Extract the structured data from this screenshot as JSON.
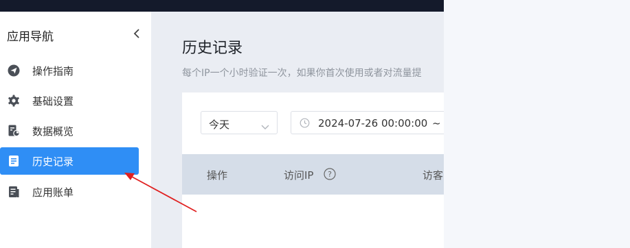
{
  "sidebar": {
    "title": "应用导航",
    "items": [
      {
        "label": "操作指南",
        "icon": "paper-plane-icon",
        "active": false
      },
      {
        "label": "基础设置",
        "icon": "gear-icon",
        "active": false
      },
      {
        "label": "数据概览",
        "icon": "data-overview-icon",
        "active": false
      },
      {
        "label": "历史记录",
        "icon": "document-icon",
        "active": true
      },
      {
        "label": "应用账单",
        "icon": "bill-icon",
        "active": false
      }
    ]
  },
  "page": {
    "title": "历史记录",
    "description": "每个IP一个小时验证一次，如果你首次使用或者对流量提"
  },
  "filters": {
    "range": "今天",
    "date_start": "2024-07-26 00:00:00",
    "date_separator": "~"
  },
  "table": {
    "columns": [
      "操作",
      "访问IP",
      "访客"
    ]
  },
  "colors": {
    "accent": "#2f8ef5",
    "topbar": "#141a2b",
    "annotation_arrow": "#e02020"
  }
}
